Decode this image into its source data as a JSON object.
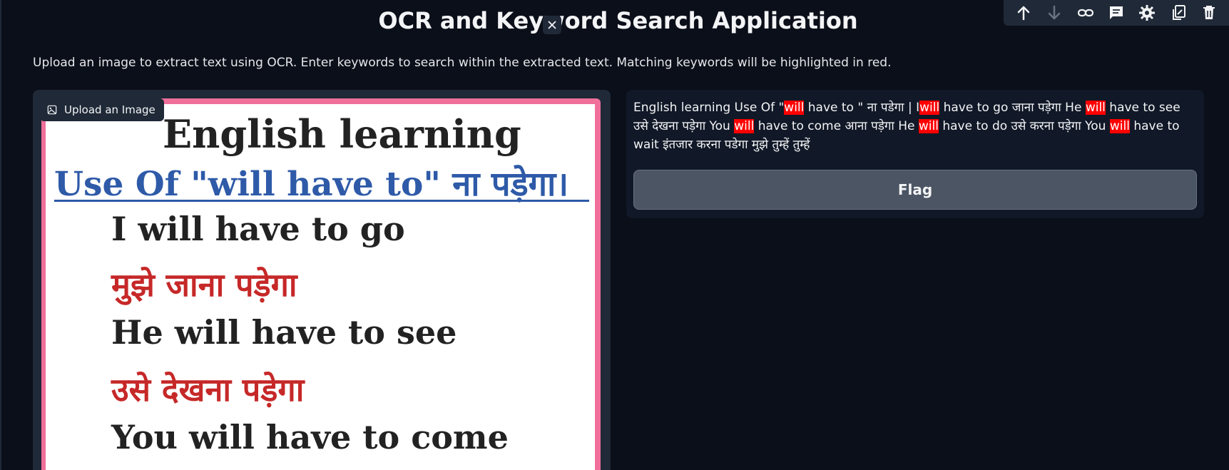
{
  "app": {
    "title": "OCR and Keyword Search Application",
    "description": "Upload an image to extract text using OCR. Enter keywords to search within the extracted text. Matching keywords will be highlighted in red."
  },
  "toolbar": {
    "icons": [
      "arrow-up-icon",
      "arrow-down-icon",
      "link-icon",
      "comment-icon",
      "gear-icon",
      "copy-icon",
      "trash-icon"
    ]
  },
  "image_panel": {
    "upload_label": "Upload an Image",
    "image_text": {
      "line1": "English learning",
      "line2": "Use Of \"will have to\" ना पड़ेगा।",
      "line3": "I will have to go",
      "line4": "मुझे जाना पड़ेगा",
      "line5": "He will have to see",
      "line6": "उसे देखना पड़ेगा",
      "line7": "You will have to come"
    }
  },
  "result": {
    "segments": [
      {
        "text": "English learning Use Of \"",
        "hl": false
      },
      {
        "text": "will",
        "hl": true
      },
      {
        "text": " have to \" ना पडेगा | I",
        "hl": false
      },
      {
        "text": "will",
        "hl": true
      },
      {
        "text": " have to go जाना पड़ेगा He ",
        "hl": false
      },
      {
        "text": "will",
        "hl": true
      },
      {
        "text": " have to see उसे देखना पड़ेगा You ",
        "hl": false
      },
      {
        "text": "will",
        "hl": true
      },
      {
        "text": " have to come आना पड़ेगा He ",
        "hl": false
      },
      {
        "text": "will",
        "hl": true
      },
      {
        "text": " have to do उसे करना पड़ेगा You ",
        "hl": false
      },
      {
        "text": "will",
        "hl": true
      },
      {
        "text": " have to wait इंतजार करना पडेगा मुझे तुम्हें तुम्हें",
        "hl": false
      }
    ],
    "flag_label": "Flag"
  },
  "colors": {
    "background": "#0b0f19",
    "panel": "#1f2937",
    "highlight": "#ff0000",
    "image_border": "#f06f9a"
  }
}
